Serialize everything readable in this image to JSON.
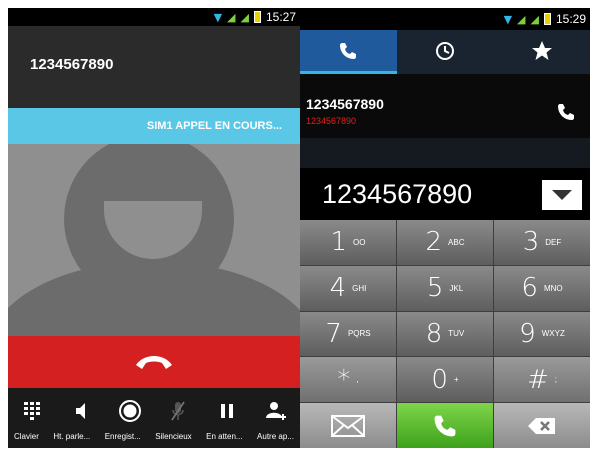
{
  "left": {
    "status_time": "15:27",
    "caller_number": "1234567890",
    "call_status": "SIM1 APPEL EN COURS...",
    "actions": [
      {
        "label": "Clavier",
        "icon": "keypad-icon"
      },
      {
        "label": "Ht. parle...",
        "icon": "speaker-icon"
      },
      {
        "label": "Enregist...",
        "icon": "record-icon"
      },
      {
        "label": "Silencieux",
        "icon": "mute-icon"
      },
      {
        "label": "En atten...",
        "icon": "pause-icon"
      },
      {
        "label": "Autre ap...",
        "icon": "add-call-icon"
      }
    ]
  },
  "right": {
    "status_time": "15:29",
    "tabs": [
      {
        "icon": "phone-icon",
        "active": true
      },
      {
        "icon": "clock-icon",
        "active": false
      },
      {
        "icon": "star-icon",
        "active": false
      }
    ],
    "log_number": "1234567890",
    "log_sub": "1234567890",
    "display_number": "1234567890",
    "keys": [
      {
        "digit": "1",
        "letters": "OO"
      },
      {
        "digit": "2",
        "letters": "ABC"
      },
      {
        "digit": "3",
        "letters": "DEF"
      },
      {
        "digit": "4",
        "letters": "GHI"
      },
      {
        "digit": "5",
        "letters": "JKL"
      },
      {
        "digit": "6",
        "letters": "MNO"
      },
      {
        "digit": "7",
        "letters": "PQRS"
      },
      {
        "digit": "8",
        "letters": "TUV"
      },
      {
        "digit": "9",
        "letters": "WXYZ"
      },
      {
        "digit": "*",
        "letters": ","
      },
      {
        "digit": "0",
        "letters": "+"
      },
      {
        "digit": "#",
        "letters": ";"
      }
    ]
  },
  "colors": {
    "accent_blue": "#33b5e5",
    "end_call_red": "#d42020",
    "call_green": "#4cba26"
  }
}
